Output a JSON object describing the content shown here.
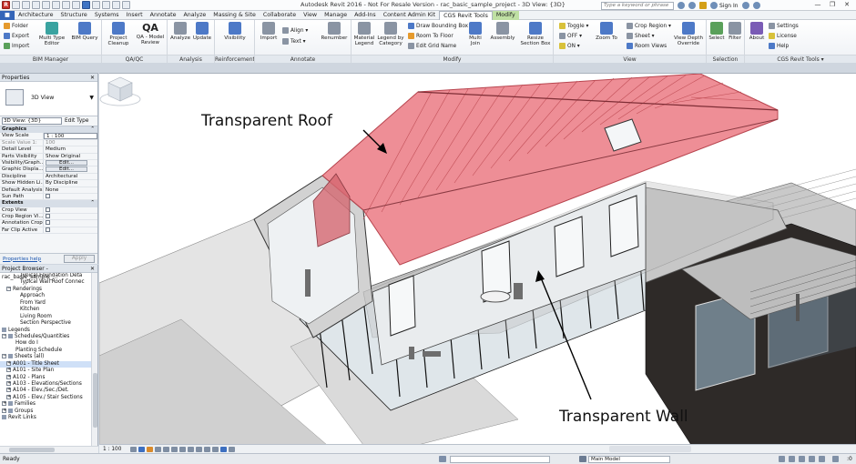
{
  "app": {
    "title": "Autodesk Revit 2016 - Not For Resale Version -   rac_basic_sample_project - 3D View: {3D}",
    "search_placeholder": "Type a keyword or phrase",
    "sign_in": "Sign In",
    "window_controls": [
      "—",
      "❐",
      "✕"
    ]
  },
  "tabs": [
    {
      "label": "",
      "kind": "file"
    },
    {
      "label": "Architecture",
      "kind": "normal"
    },
    {
      "label": "Structure",
      "kind": "normal"
    },
    {
      "label": "Systems",
      "kind": "normal"
    },
    {
      "label": "Insert",
      "kind": "normal"
    },
    {
      "label": "Annotate",
      "kind": "normal"
    },
    {
      "label": "Analyze",
      "kind": "normal"
    },
    {
      "label": "Massing & Site",
      "kind": "normal"
    },
    {
      "label": "Collaborate",
      "kind": "normal"
    },
    {
      "label": "View",
      "kind": "normal"
    },
    {
      "label": "Manage",
      "kind": "normal"
    },
    {
      "label": "Add-Ins",
      "kind": "normal"
    },
    {
      "label": "Content Admin Kit",
      "kind": "normal"
    },
    {
      "label": "CGS Revit Tools",
      "kind": "active"
    },
    {
      "label": "Modify",
      "kind": "contextual"
    }
  ],
  "ribbon": {
    "bim_manager": {
      "label": "BIM Manager",
      "small": [
        "Folder",
        "Export",
        "Import"
      ],
      "big": [
        [
          "Multi Type",
          "Editor"
        ],
        [
          "BIM Query"
        ]
      ]
    },
    "qa_qc": {
      "label": "QA/QC",
      "big": [
        [
          "Project",
          "Cleanup"
        ],
        [
          "QA - Model",
          "Review"
        ]
      ],
      "qa_glyph": "QA"
    },
    "analysis": {
      "label": "Analysis",
      "big": [
        [
          "Analyze"
        ],
        [
          "Update"
        ]
      ]
    },
    "reinforcement": {
      "label": "Reinforcement",
      "big": [
        [
          "Visibility"
        ]
      ]
    },
    "annotate": {
      "label": "Annotate",
      "big": [
        [
          "Import"
        ],
        [
          "Renumber"
        ]
      ],
      "small": [
        "Align ▾",
        "Text ▾"
      ]
    },
    "modify": {
      "label": "Modify",
      "big": [
        [
          "Material",
          "Legend"
        ],
        [
          "Legend by",
          "Category"
        ],
        [
          "Multi",
          "Join"
        ],
        [
          "Assembly"
        ],
        [
          "Resize",
          "Section Box"
        ]
      ],
      "small": [
        "Draw Bounding Box",
        "Room To Floor",
        "Edit Grid Name"
      ]
    },
    "view": {
      "label": "View",
      "small_a": [
        "Toggle ▾",
        "OFF ▾",
        "ON ▾"
      ],
      "big": [
        [
          "Zoom To"
        ],
        [
          "View Depth",
          "Override"
        ]
      ],
      "small_b": [
        "Crop Region ▾",
        "Sheet ▾",
        "Room Views"
      ]
    },
    "selection": {
      "label": "Selection",
      "big": [
        [
          "Select"
        ],
        [
          "Filter"
        ]
      ]
    },
    "cgs": {
      "label": "CGS Revit Tools ▾",
      "big": [
        [
          "About"
        ]
      ],
      "small": [
        "Settings",
        "License",
        "Help"
      ]
    }
  },
  "properties": {
    "title": "Properties",
    "close": "✕",
    "type_name": "3D View",
    "instance_selector": "3D View: {3D}",
    "edit_type": "Edit Type",
    "groups": [
      {
        "name": "Graphics",
        "rows": [
          {
            "k": "View Scale",
            "v": "1 : 100",
            "field": true
          },
          {
            "k": "Scale Value    1:",
            "v": "100",
            "dim": true
          },
          {
            "k": "Detail Level",
            "v": "Medium"
          },
          {
            "k": "Parts Visibility",
            "v": "Show Original"
          },
          {
            "k": "Visibility/Graph...",
            "v": "Edit...",
            "button": true
          },
          {
            "k": "Graphic Displa...",
            "v": "Edit...",
            "button": true
          },
          {
            "k": "Discipline",
            "v": "Architectural"
          },
          {
            "k": "Show Hidden Li...",
            "v": "By Discipline"
          },
          {
            "k": "Default Analysis...",
            "v": "None"
          },
          {
            "k": "Sun Path",
            "v": "",
            "checkbox": false
          }
        ]
      },
      {
        "name": "Extents",
        "rows": [
          {
            "k": "Crop View",
            "v": "",
            "checkbox": false
          },
          {
            "k": "Crop Region Vi...",
            "v": "",
            "checkbox": false
          },
          {
            "k": "Annotation Crop",
            "v": "",
            "checkbox": false
          },
          {
            "k": "Far Clip Active",
            "v": "",
            "checkbox": false
          }
        ]
      }
    ],
    "help_link": "Properties help",
    "apply": "Apply"
  },
  "browser": {
    "title": "Project Browser - rac_basic_sample_...",
    "close": "✕",
    "nodes": [
      {
        "label": "Typical Foundation Deta",
        "indent": 4,
        "toggle": ""
      },
      {
        "label": "Typical Wall Roof Connec",
        "indent": 4,
        "toggle": ""
      },
      {
        "label": "Renderings",
        "indent": 1,
        "toggle": "−"
      },
      {
        "label": "Approach",
        "indent": 4,
        "toggle": ""
      },
      {
        "label": "From Yard",
        "indent": 4,
        "toggle": ""
      },
      {
        "label": "Kitchen",
        "indent": 4,
        "toggle": ""
      },
      {
        "label": "Living Room",
        "indent": 4,
        "toggle": ""
      },
      {
        "label": "Section Perspective",
        "indent": 4,
        "toggle": ""
      },
      {
        "label": "Legends",
        "indent": 0,
        "toggle": "",
        "icon": true
      },
      {
        "label": "Schedules/Quantities",
        "indent": 0,
        "toggle": "−",
        "icon": true
      },
      {
        "label": "How do I",
        "indent": 3,
        "toggle": ""
      },
      {
        "label": "Planting Schedule",
        "indent": 3,
        "toggle": ""
      },
      {
        "label": "Sheets (all)",
        "indent": 0,
        "toggle": "−",
        "icon": true
      },
      {
        "label": "A001 - Title Sheet",
        "indent": 1,
        "toggle": "+",
        "selected": true
      },
      {
        "label": "A101 - Site Plan",
        "indent": 1,
        "toggle": "+"
      },
      {
        "label": "A102 - Plans",
        "indent": 1,
        "toggle": "+"
      },
      {
        "label": "A103 - Elevations/Sections",
        "indent": 1,
        "toggle": "+"
      },
      {
        "label": "A104 - Elev./Sec./Det.",
        "indent": 1,
        "toggle": "+"
      },
      {
        "label": "A105 - Elev./ Stair Sections",
        "indent": 1,
        "toggle": "+"
      },
      {
        "label": "Families",
        "indent": 0,
        "toggle": "+",
        "icon": true
      },
      {
        "label": "Groups",
        "indent": 0,
        "toggle": "+",
        "icon": true
      },
      {
        "label": "Revit Links",
        "indent": 0,
        "toggle": "",
        "icon": true
      }
    ]
  },
  "view": {
    "annotations": {
      "roof": "Transparent Roof",
      "wall": "Transparent Wall"
    },
    "viewcube_label": "FRONT",
    "colors": {
      "roof": "#e7636d",
      "roof_line": "#b8454f",
      "wall": "#b9b9b9",
      "ground": "#d9d9d9"
    }
  },
  "viewbar": {
    "scale": "1 : 100"
  },
  "status": {
    "ready": "Ready",
    "model": "Main Model",
    "filter_count": ":0"
  }
}
